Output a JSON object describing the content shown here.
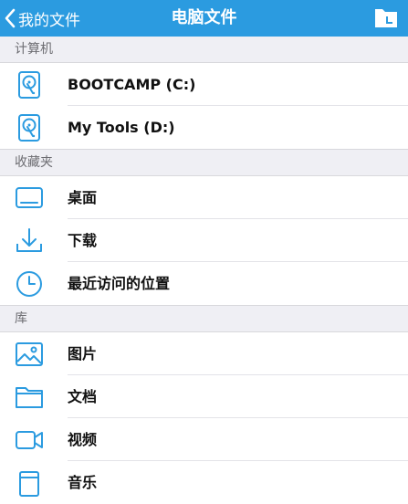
{
  "nav": {
    "back_label": "我的文件",
    "title": "电脑文件",
    "action_icon": "folder-chart-icon"
  },
  "sections": [
    {
      "header": "计算机",
      "items": [
        {
          "label": "BOOTCAMP (C:)",
          "icon": "hard-drive-icon"
        },
        {
          "label": "My Tools (D:)",
          "icon": "hard-drive-icon"
        }
      ]
    },
    {
      "header": "收藏夹",
      "items": [
        {
          "label": "桌面",
          "icon": "desktop-icon"
        },
        {
          "label": "下载",
          "icon": "download-icon"
        },
        {
          "label": "最近访问的位置",
          "icon": "clock-icon"
        }
      ]
    },
    {
      "header": "库",
      "items": [
        {
          "label": "图片",
          "icon": "image-icon"
        },
        {
          "label": "文档",
          "icon": "folder-icon"
        },
        {
          "label": "视频",
          "icon": "video-camera-icon"
        },
        {
          "label": "音乐",
          "icon": "music-icon"
        }
      ]
    }
  ],
  "colors": {
    "accent": "#2b9be0",
    "section_bg": "#efeff4",
    "icon": "#2b9be0"
  }
}
